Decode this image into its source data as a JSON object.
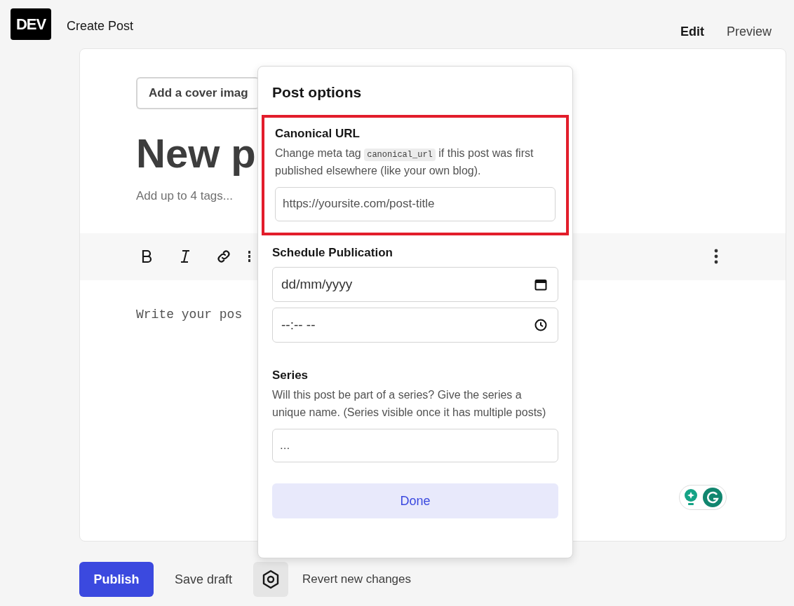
{
  "header": {
    "logo": "DEV",
    "title": "Create Post",
    "tabs": [
      {
        "label": "Edit",
        "selected": true
      },
      {
        "label": "Preview",
        "selected": false
      }
    ]
  },
  "editor": {
    "cover_button": "Add a cover imag",
    "title": "New p",
    "tags_placeholder": "Add up to 4 tags...",
    "body_placeholder": "Write your pos"
  },
  "post_options": {
    "title": "Post options",
    "canonical": {
      "highlighted": true,
      "label": "Canonical URL",
      "description_before": "Change meta tag ",
      "code": "canonical_url",
      "description_after": " if this post was first published elsewhere (like your own blog).",
      "placeholder": "https://yoursite.com/post-title"
    },
    "schedule": {
      "label": "Schedule Publication",
      "date_placeholder": "dd/mm/yyyy",
      "time_placeholder": "--:-- --"
    },
    "series": {
      "label": "Series",
      "description": "Will this post be part of a series? Give the series a unique name. (Series visible once it has multiple posts)",
      "placeholder": "..."
    },
    "done_button": "Done"
  },
  "footer": {
    "publish_button": "Publish",
    "save_draft": "Save draft",
    "revert": "Revert new changes"
  }
}
